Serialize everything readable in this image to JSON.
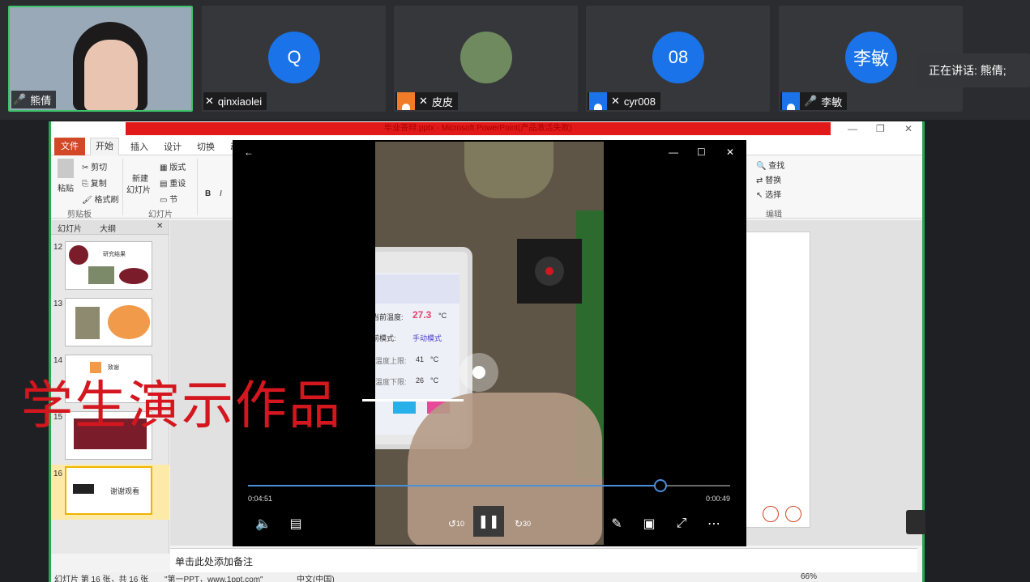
{
  "participants": [
    {
      "name": "熊倩",
      "avatar": "",
      "mic": "on"
    },
    {
      "name": "qinxiaolei",
      "avatar": "Q",
      "mic": "muted"
    },
    {
      "name": "皮皮",
      "avatar": "",
      "mic": "muted"
    },
    {
      "name": "cyr008",
      "avatar": "08",
      "mic": "muted"
    },
    {
      "name": "李敏",
      "avatar": "李敏",
      "mic": "on"
    }
  ],
  "speaking": "正在讲话: 熊倩;",
  "ppt": {
    "title": "毕业答辩.pptx - Microsoft PowerPoint(产品激活失败)",
    "tabs": [
      "文件",
      "开始",
      "插入",
      "设计",
      "切换",
      "动"
    ],
    "ribbon": {
      "paste": "粘贴",
      "cut": "剪切",
      "copy": "复制",
      "format_painter": "格式刷",
      "clipboard": "剪贴板",
      "new_slide": "新建",
      "new_slide2": "幻灯片",
      "layout": "版式",
      "reset": "重设",
      "section": "节",
      "slides_group": "幻灯片",
      "bold": "B",
      "italic": "I",
      "find": "查找",
      "replace": "替换",
      "select": "选择",
      "editing": "编辑"
    },
    "panel_tabs": [
      "幻灯片",
      "大纲"
    ],
    "slides": [
      {
        "num": "12",
        "text": "研究结果"
      },
      {
        "num": "13",
        "text": ""
      },
      {
        "num": "14",
        "text": "致谢"
      },
      {
        "num": "15",
        "text": ""
      },
      {
        "num": "16",
        "text": "谢谢观看"
      }
    ],
    "notes_placeholder": "单击此处添加备注",
    "status": {
      "slide_count": "幻灯片 第 16 张，共 16 张",
      "theme": "\"第一PPT，www.1ppt.com\"",
      "language": "中文(中国)",
      "zoom": "66%"
    }
  },
  "player": {
    "elapsed": "0:04:51",
    "remaining": "0:00:49",
    "progress": 0.855,
    "rewind_label": "10",
    "forward_label": "30"
  },
  "phone_app": {
    "current_temp_label": "当前温度:",
    "current_temp": "27.3",
    "temp_unit": "°C",
    "mode_label": "前模式:",
    "mode": "手动模式",
    "upper_label": "温度上限:",
    "upper": "41",
    "lower_label": "温度下限:",
    "lower": "26",
    "unit_c": "°C"
  },
  "overlay_title": "学生演示作品"
}
